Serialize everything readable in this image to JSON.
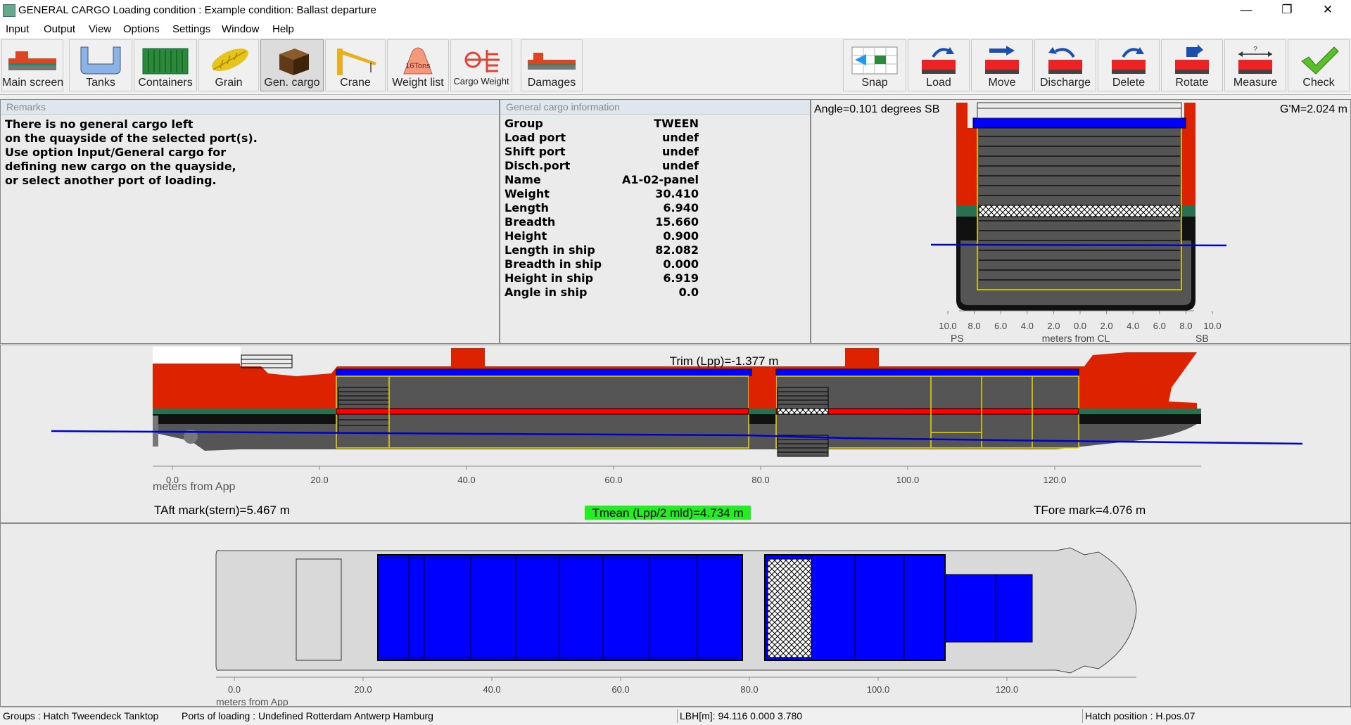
{
  "window": {
    "title": "GENERAL CARGO  Loading condition : Example condition: Ballast departure",
    "minimize": "—",
    "restore": "❐",
    "close": "✕"
  },
  "menu": [
    "Input",
    "Output",
    "View",
    "Options",
    "Settings",
    "Window",
    "Help"
  ],
  "toolbar_left": [
    {
      "label": "Main screen",
      "icon": "ship-icon"
    },
    {
      "label": "Tanks",
      "icon": "tank-icon"
    },
    {
      "label": "Containers",
      "icon": "container-icon"
    },
    {
      "label": "Grain",
      "icon": "grain-icon"
    },
    {
      "label": "Gen. cargo",
      "icon": "crate-icon"
    },
    {
      "label": "Crane",
      "icon": "crane-icon"
    },
    {
      "label": "Weight list",
      "icon": "weight-icon",
      "icon_text": "16Tons"
    },
    {
      "label": "Cargo Weight",
      "icon": "cargo-weight-icon"
    },
    {
      "label": "Damages",
      "icon": "damaged-ship-icon"
    }
  ],
  "toolbar_right": [
    {
      "label": "Snap",
      "icon": "snap-grid-icon"
    },
    {
      "label": "Load",
      "icon": "load-arrow-icon"
    },
    {
      "label": "Move",
      "icon": "move-arrow-icon"
    },
    {
      "label": "Discharge",
      "icon": "discharge-arrow-icon"
    },
    {
      "label": "Delete",
      "icon": "delete-arrow-icon"
    },
    {
      "label": "Rotate",
      "icon": "rotate-icon"
    },
    {
      "label": "Measure",
      "icon": "measure-icon"
    },
    {
      "label": "Check",
      "icon": "checkmark-icon"
    }
  ],
  "remarks": {
    "header": "Remarks",
    "lines": [
      "There is no general cargo left",
      "on the quayside of the selected port(s).",
      "Use option Input/General cargo for",
      "defining new cargo on the quayside,",
      "or select another port of loading."
    ]
  },
  "cargo_info": {
    "header": "General cargo information",
    "rows": [
      {
        "k": "Group",
        "v": "TWEEN"
      },
      {
        "k": "Load port",
        "v": "undef"
      },
      {
        "k": "Shift port",
        "v": "undef"
      },
      {
        "k": "Disch.port",
        "v": "undef"
      },
      {
        "k": "Name",
        "v": "A1-02-panel"
      },
      {
        "k": "Weight",
        "v": "30.410"
      },
      {
        "k": "Length",
        "v": "6.940"
      },
      {
        "k": "Breadth",
        "v": "15.660"
      },
      {
        "k": "Height",
        "v": "0.900"
      },
      {
        "k": "Length in ship",
        "v": "82.082"
      },
      {
        "k": "Breadth in ship",
        "v": "0.000"
      },
      {
        "k": "Height in ship",
        "v": "6.919"
      },
      {
        "k": "Angle in ship",
        "v": "0.0"
      }
    ]
  },
  "cross_section": {
    "angle": "Angle=0.101 degrees SB",
    "gm": "G'M=2.024 m",
    "ticks": [
      "10.0",
      "8.0",
      "6.0",
      "4.0",
      "2.0",
      "0.0",
      "2.0",
      "4.0",
      "6.0",
      "8.0",
      "10.0"
    ],
    "label_ps": "PS",
    "label_sb": "SB",
    "axis_label": "meters from CL"
  },
  "profile": {
    "trim": "Trim (Lpp)=-1.377 m",
    "ticks": [
      "0.0",
      "20.0",
      "40.0",
      "60.0",
      "80.0",
      "100.0",
      "120.0"
    ],
    "axis_label": "meters from App",
    "aft_mark": "TAft mark(stern)=5.467 m",
    "tmean": "Tmean (Lpp/2 mld)=4.734 m",
    "fore_mark": "TFore mark=4.076 m"
  },
  "plan": {
    "ticks": [
      "0.0",
      "20.0",
      "40.0",
      "60.0",
      "80.0",
      "100.0",
      "120.0"
    ],
    "axis_label": "meters from App"
  },
  "status": {
    "groups": "Groups :  Hatch Tweendeck Tanktop",
    "ports": "Ports of loading :  Undefined Rotterdam Antwerp Hamburg",
    "lbh": "LBH[m]: 94.116  0.000  3.780",
    "hatch": "Hatch position : H.pos.07"
  },
  "colors": {
    "hull_red": "#dd2200",
    "hull_gray": "#555555",
    "cargo_blue": "#0000ff",
    "hatch_yellow": "#e8d800",
    "waterline": "#0000cc",
    "tmean_bg": "#22ee22"
  }
}
